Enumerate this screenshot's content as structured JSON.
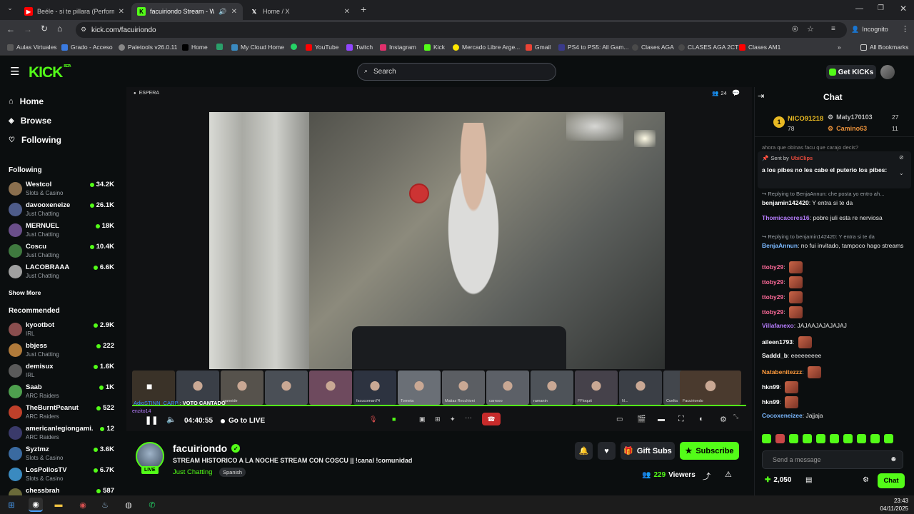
{
  "browser": {
    "tabs": [
      {
        "title": "Beéle - si te pillara (Performanc",
        "icon": "youtube-icon"
      },
      {
        "title": "facuiriondo Stream - Watch",
        "icon": "kick-icon"
      },
      {
        "title": "Home / X",
        "icon": "x-icon"
      }
    ],
    "url": "kick.com/facuiriondo",
    "incognito_label": "Incognito",
    "bookmarks": [
      "Aulas Virtuales",
      "Grado - Acceso",
      "Paletools v26.0.11",
      "Home",
      "My Cloud Home",
      "YouTube",
      "Twitch",
      "Instagram",
      "Kick",
      "Mercado Libre Arge...",
      "Gmail",
      "PS4 to PS5: All Gam...",
      "Clases AGA",
      "CLASES AGA 2CT",
      "Clases AM1"
    ],
    "all_bookmarks": "All Bookmarks"
  },
  "header": {
    "logo": "KICK",
    "logo_badge": "BETA",
    "search_placeholder": "Search",
    "get_kicks": "Get KICKs"
  },
  "sidebar": {
    "nav": [
      {
        "label": "Home",
        "icon": "home-icon"
      },
      {
        "label": "Browse",
        "icon": "compass-icon"
      },
      {
        "label": "Following",
        "icon": "heart-icon"
      }
    ],
    "following_title": "Following",
    "following": [
      {
        "name": "Westcol",
        "category": "Slots & Casino",
        "viewers": "34.2K",
        "color": "#8a6f4e"
      },
      {
        "name": "davooxeneize",
        "category": "Just Chatting",
        "viewers": "26.1K",
        "color": "#4e5c8a"
      },
      {
        "name": "MERNUEL",
        "category": "Just Chatting",
        "viewers": "18K",
        "color": "#6a4e8a"
      },
      {
        "name": "Coscu",
        "category": "Just Chatting",
        "viewers": "10.4K",
        "color": "#3f7a3f"
      },
      {
        "name": "LACOBRAAA",
        "category": "Just Chatting",
        "viewers": "6.6K",
        "color": "#a0a0a0"
      }
    ],
    "show_more": "Show More",
    "recommended_title": "Recommended",
    "recommended": [
      {
        "name": "kyootbot",
        "category": "IRL",
        "viewers": "2.9K",
        "color": "#8a4e4e"
      },
      {
        "name": "bbjess",
        "category": "Just Chatting",
        "viewers": "222",
        "color": "#b07a3a"
      },
      {
        "name": "demisux",
        "category": "IRL",
        "viewers": "1.6K",
        "color": "#5a5a5a"
      },
      {
        "name": "Saab",
        "category": "ARC Raiders",
        "viewers": "1K",
        "color": "#4ea04e"
      },
      {
        "name": "TheBurntPeanut",
        "category": "ARC Raiders",
        "viewers": "522",
        "color": "#c0402a"
      },
      {
        "name": "americanlegiongami...",
        "category": "ARC Raiders",
        "viewers": "12",
        "color": "#3a3a6a"
      },
      {
        "name": "Syztmz",
        "category": "Slots & Casino",
        "viewers": "3.6K",
        "color": "#3a6aa0"
      },
      {
        "name": "LosPollosTV",
        "category": "Slots & Casino",
        "viewers": "6.7K",
        "color": "#3a8ac0"
      },
      {
        "name": "chessbrah",
        "category": "",
        "viewers": "587",
        "color": "#6a6a3a"
      }
    ]
  },
  "player": {
    "status": "ESPERA",
    "participants": "24",
    "overlay_user": "enzito14",
    "overlay_text1": "AdioSTINN_CARP",
    "overlay_text2": "VOTO CANTADO",
    "thumbnails": [
      "",
      "",
      "nanoide",
      "",
      "",
      "facucoman74",
      "Torneta",
      "Matias Recchioni",
      "carrooo",
      "ramanin",
      "FFloquit",
      "N...",
      "Cuelta",
      "Facuiriondo"
    ],
    "elapsed": "04:40:55",
    "go_live": "Go to LIVE"
  },
  "stream": {
    "streamer": "facuiriondo",
    "title": "STREAM HISTORICO A LA NOCHE STREAM CON COSCU || !canal !comunidad",
    "category": "Just Chatting",
    "tag": "Spanish",
    "live_badge": "LIVE",
    "gift_subs": "Gift Subs",
    "subscribe": "Subscribe",
    "viewers_count": "229",
    "viewers_label": "Viewers"
  },
  "chat": {
    "title": "Chat",
    "leaderboard": {
      "rank1_name": "NICO91218",
      "rank1_value": "78",
      "p2_name": "Maty170103",
      "p2_value": "27",
      "p3_name": "Camino63",
      "p3_value": "11"
    },
    "cutoff_text": "ahora  que obinas facu  que carajo decis?",
    "pinned": {
      "sent_by": "Sent by",
      "sender": "UbiClips",
      "text": "a los pibes no les cabe el puterio los pibes:"
    },
    "messages": [
      {
        "reply": "Replying to BenjaAnnun: che posta yo entro ah...",
        "user": "benjamin142420",
        "color": "#ffffff",
        "text": "Y entra si te da"
      },
      {
        "user": "Thomicaceres16",
        "color": "#b77dff",
        "text": "pobre juli esta re nerviosa"
      },
      {
        "reply": "Replying to benjamin142420: Y entra si te da",
        "user": "BenjaAnnun",
        "color": "#7ab8ff",
        "text": "no fui invitado, tampoco hago streams"
      },
      {
        "user": "ttoby29",
        "color": "#ff6b9a",
        "text": ""
      },
      {
        "user": "ttoby29",
        "color": "#ff6b9a",
        "text": ""
      },
      {
        "user": "ttoby29",
        "color": "#ff6b9a",
        "text": ""
      },
      {
        "user": "ttoby29",
        "color": "#ff6b9a",
        "text": ""
      },
      {
        "user": "Villafanexo",
        "color": "#b77dff",
        "text": "JAJAAJAJAJAJAJ"
      },
      {
        "user": "aileen1793",
        "color": "#ffffff",
        "text": ""
      },
      {
        "user": "Saddd_b",
        "color": "#ffffff",
        "text": "eeeeeeeee"
      },
      {
        "user": "Natabenitezzz",
        "color": "#ff9a3c",
        "text": ""
      },
      {
        "user": "hkn99",
        "color": "#ffffff",
        "text": ""
      },
      {
        "user": "hkn99",
        "color": "#ffffff",
        "text": ""
      },
      {
        "user": "Cocoxeneizee",
        "color": "#7ab8ff",
        "text": "Jajjaja"
      }
    ],
    "input_placeholder": "Send a message",
    "points": "2,050",
    "chat_button": "Chat"
  },
  "taskbar": {
    "time": "23:43",
    "date": "04/11/2025"
  }
}
